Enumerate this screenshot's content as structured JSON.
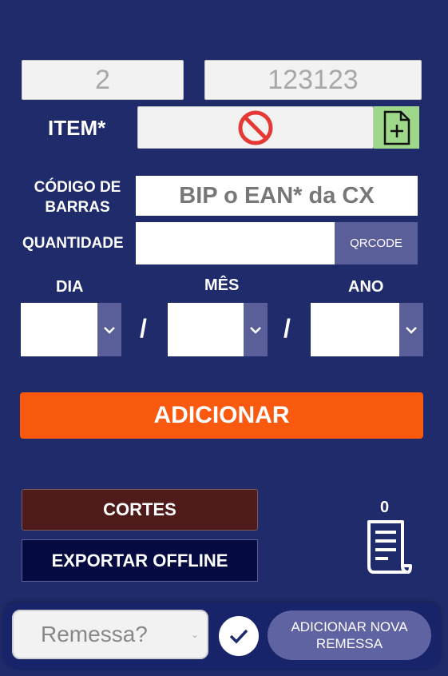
{
  "header": {
    "field_left": "2",
    "field_right": "123123"
  },
  "item": {
    "label": "ITEM*"
  },
  "barcode": {
    "label_line1": "CÓDIGO DE",
    "label_line2": "BARRAS",
    "placeholder": "BIP o EAN* da CX"
  },
  "quantity": {
    "label": "QUANTIDADE",
    "value": "",
    "qrcode_label": "QRCODE"
  },
  "date": {
    "day_label": "DIA",
    "month_label": "MÊS",
    "year_label": "ANO",
    "separator": "/"
  },
  "add_button": "ADICIONAR",
  "cortes_button": "CORTES",
  "export_button": "EXPORTAR OFFLINE",
  "receipt_count": "0",
  "bottom": {
    "remessa_placeholder": "Remessa?",
    "add_remessa_line1": "ADICIONAR NOVA",
    "add_remessa_line2": "REMESSA"
  },
  "colors": {
    "background": "#1f2b6b",
    "accent_orange": "#f95a10",
    "cortes": "#4e1a1a",
    "export": "#050a40",
    "green_icon_bg": "#9fd88a",
    "chevron_bg": "#5a5f99"
  }
}
